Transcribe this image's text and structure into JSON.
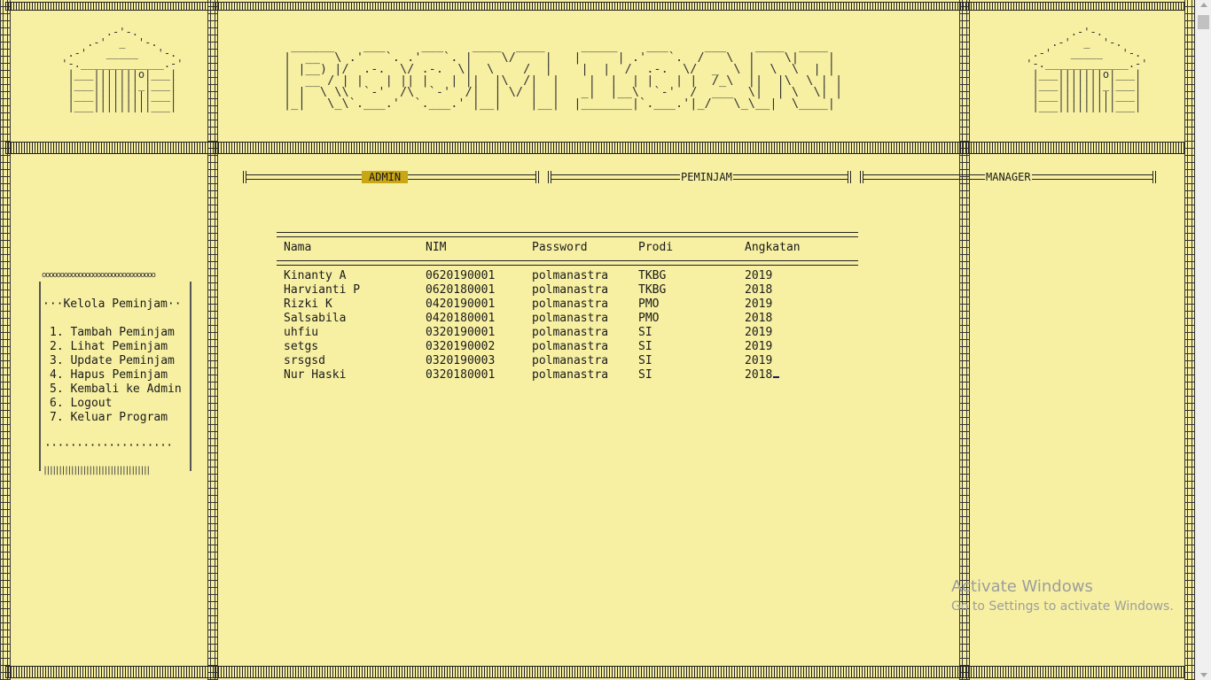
{
  "app": {
    "title_art_lines": [
      " ______    ___     ___    ____  ____     _____    ___     ___    ____  ____",
      "|  __  \\ .'   `. .'   `. |    \\/    |   |     | .'   `.  /   \\  |    \\|    |",
      "| |__) |/  .-.  \\/ .-.  \\|  \\    /  |    |  |  /  .-.  \\/  _  \\ |  \\  \\  | |",
      "|  __ / | |   | || |   | ||  |\\  /|  |    |  |  | |   | |  /_\\  ||  |\\  \\ | |",
      "| |  \\ \\\\  `-'  /\\  `-'  /|  | \\/ |  |   _|  |__\\  `-'  /  ___  \\|  | \\  \\| |",
      "|_|   \\_\\`.___.'  `.___.' |__|    |__|  |_______|`.___.'|_/   \\_\\__|  \\____|"
    ],
    "house_art_lines": [
      "        .-'-.",
      "     .-'  _  '-.",
      "  .-'   _____   '-.",
      " '-._____________.-'",
      "  |___|||||||o|___|",
      "  |___|||||||_|___|",
      "  |___|||||||||___|",
      "  |___|||||||||___|"
    ]
  },
  "tabs": [
    {
      "label": "ADMIN",
      "active": true
    },
    {
      "label": "PEMINJAM",
      "active": false
    },
    {
      "label": "MANAGER",
      "active": false
    }
  ],
  "table": {
    "headers": [
      "Nama",
      "NIM",
      "Password",
      "Prodi",
      "Angkatan"
    ],
    "rows": [
      [
        "Kinanty A",
        "0620190001",
        "polmanastra",
        "TKBG",
        "2019"
      ],
      [
        "Harvianti P",
        "0620180001",
        "polmanastra",
        "TKBG",
        "2018"
      ],
      [
        "Rizki K",
        "0420190001",
        "polmanastra",
        "PMO",
        "2019"
      ],
      [
        "Salsabila",
        "0420180001",
        "polmanastra",
        "PMO",
        "2018"
      ],
      [
        "uhfiu",
        "0320190001",
        "polmanastra",
        "SI",
        "2019"
      ],
      [
        "setgs",
        "0320190002",
        "polmanastra",
        "SI",
        "2019"
      ],
      [
        "srsgsd",
        "0320190003",
        "polmanastra",
        "SI",
        "2019"
      ],
      [
        "Nur Haski",
        "0320180001",
        "polmanastra",
        "SI",
        "2018"
      ]
    ]
  },
  "menu": {
    "top_border": "ooooooooooooooooooooooooooooooo",
    "title": "···Kelola Peminjam··",
    "items": [
      "1. Tambah Peminjam",
      "2. Lihat Peminjam",
      "3. Update Peminjam",
      "4. Hapus Peminjam",
      "5. Kembali ke Admin",
      "6. Logout",
      "7. Keluar Program"
    ],
    "dots": "····················",
    "bottom_border": "|||||||||||||||||||||||||||||||||||"
  },
  "watermark": {
    "title": "Activate Windows",
    "subtitle": "Go to Settings to activate Windows."
  },
  "colors": {
    "background": "#f7f0a3",
    "active_tab": "#c9a614",
    "text": "#1a1a1a"
  }
}
